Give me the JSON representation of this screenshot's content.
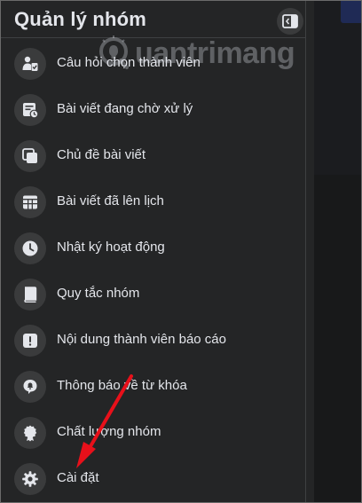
{
  "panel": {
    "title": "Quản lý nhóm",
    "collapse_icon": "sidebar-collapse-icon"
  },
  "menu": [
    {
      "label": "Câu hỏi chọn thành viên",
      "icon": "membership-questions-icon"
    },
    {
      "label": "Bài viết đang chờ xử lý",
      "icon": "pending-posts-icon"
    },
    {
      "label": "Chủ đề bài viết",
      "icon": "post-topics-icon"
    },
    {
      "label": "Bài viết đã lên lịch",
      "icon": "scheduled-posts-icon"
    },
    {
      "label": "Nhật ký hoạt động",
      "icon": "activity-log-icon"
    },
    {
      "label": "Quy tắc nhóm",
      "icon": "group-rules-icon"
    },
    {
      "label": "Nội dung thành viên báo cáo",
      "icon": "member-reported-icon"
    },
    {
      "label": "Thông báo về từ khóa",
      "icon": "keyword-alerts-icon"
    },
    {
      "label": "Chất lượng nhóm",
      "icon": "group-quality-icon"
    },
    {
      "label": "Cài đặt",
      "icon": "settings-icon"
    }
  ],
  "watermark": {
    "text": "uantrimang"
  },
  "annotation": {
    "color": "#e8101a",
    "icon": "red-arrow-annotation"
  }
}
